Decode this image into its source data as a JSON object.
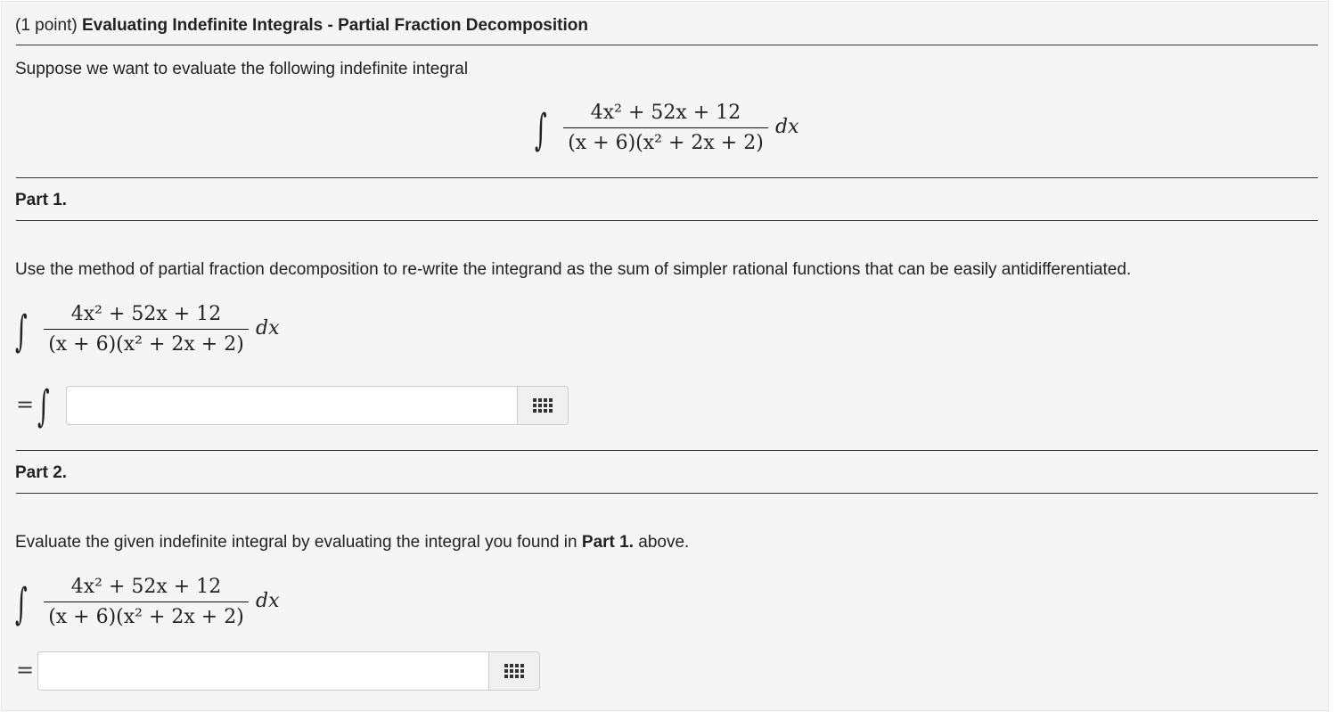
{
  "header": {
    "points": "(1 point)",
    "title": "Evaluating Indefinite Integrals - Partial Fraction Decomposition"
  },
  "intro": {
    "text": "Suppose we want to evaluate the following indefinite integral"
  },
  "integral": {
    "numerator": "4x² + 52x + 12",
    "denominator": "(x + 6)(x² + 2x + 2)",
    "differential": "dx"
  },
  "part1": {
    "heading": "Part 1.",
    "instructions": "Use the method of partial fraction decomposition to re-write the integrand as the sum of simpler rational functions that can be easily antidifferentiated.",
    "equals": "=",
    "answer": {
      "value": "",
      "placeholder": ""
    }
  },
  "part2": {
    "heading": "Part 2.",
    "instructions_before": "Evaluate the given indefinite integral by evaluating the integral you found in ",
    "instructions_bold": "Part 1.",
    "instructions_after": " above.",
    "equals": "=",
    "answer": {
      "value": "",
      "placeholder": ""
    }
  },
  "icons": {
    "palette": "equation-editor-grid-icon"
  }
}
